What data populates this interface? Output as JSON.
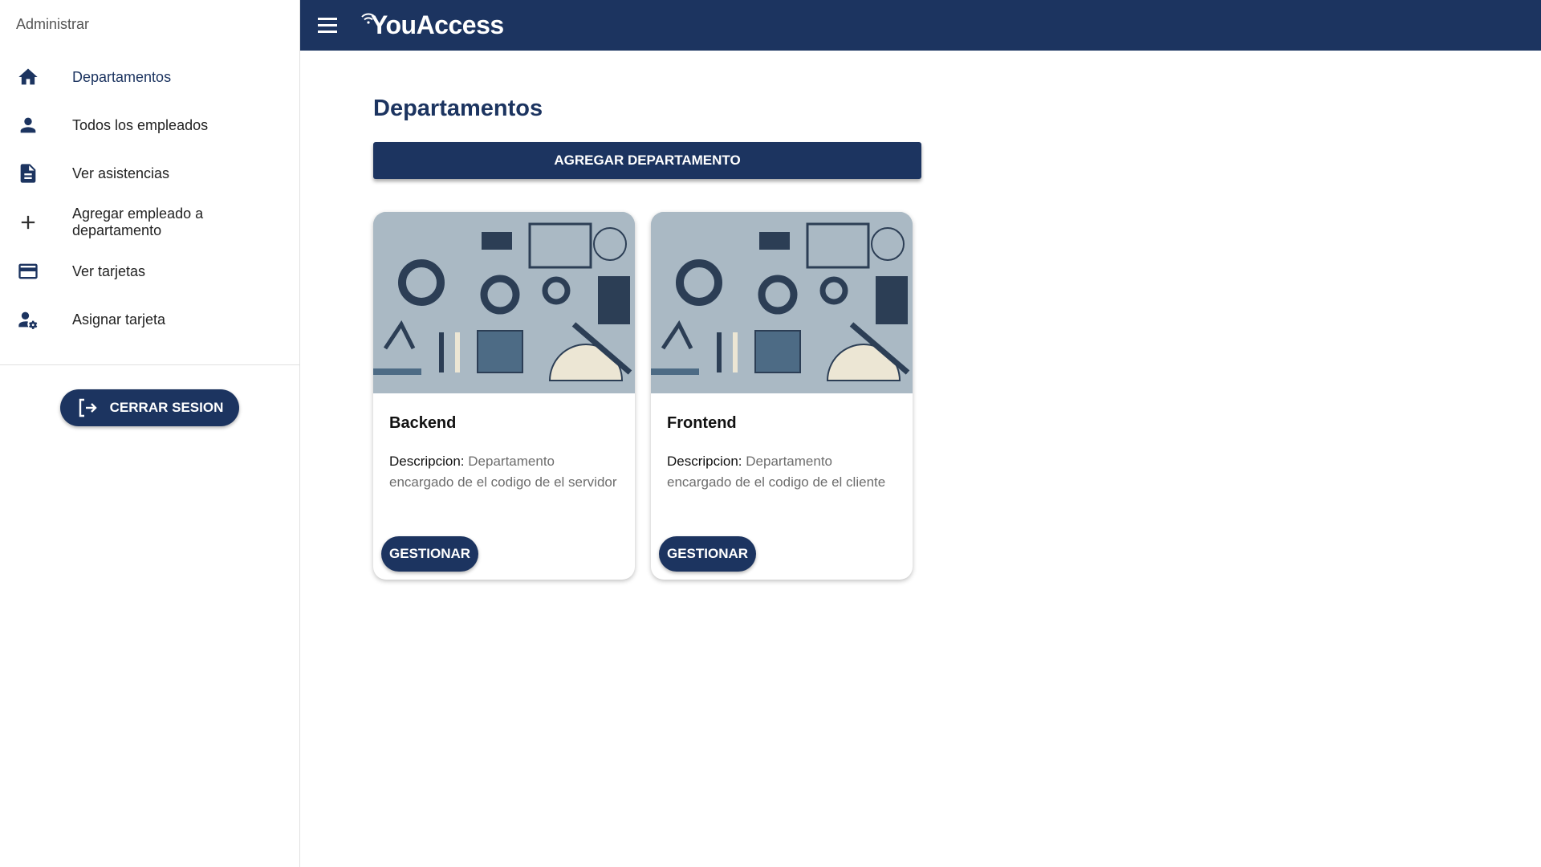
{
  "sidebar": {
    "header": "Administrar",
    "items": [
      {
        "label": "Departamentos",
        "icon": "home-icon"
      },
      {
        "label": "Todos los empleados",
        "icon": "person-icon"
      },
      {
        "label": "Ver asistencias",
        "icon": "document-icon"
      },
      {
        "label": "Agregar empleado a departamento",
        "icon": "plus-icon"
      },
      {
        "label": "Ver tarjetas",
        "icon": "credit-card-icon"
      },
      {
        "label": "Asignar tarjeta",
        "icon": "user-settings-icon"
      }
    ],
    "logout_label": "CERRAR SESION"
  },
  "appbar": {
    "brand": "YouAccess"
  },
  "main": {
    "title": "Departamentos",
    "add_label": "AGREGAR DEPARTAMENTO",
    "cards": [
      {
        "title": "Backend",
        "desc_key": "Descripcion:",
        "desc_value": "Departamento encargado de el codigo de el servidor",
        "button": "GESTIONAR"
      },
      {
        "title": "Frontend",
        "desc_key": "Descripcion:",
        "desc_value": "Departamento encargado de el codigo de el cliente",
        "button": "GESTIONAR"
      }
    ]
  },
  "colors": {
    "primary": "#1c3460",
    "muted_text": "#6d6d6d"
  }
}
